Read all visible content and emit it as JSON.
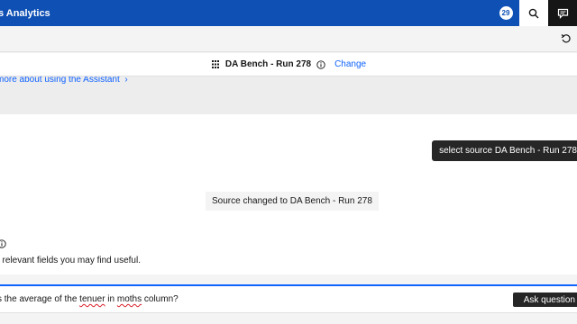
{
  "header": {
    "app_title": "s Analytics",
    "notification_count": "29"
  },
  "source_bar": {
    "source_name": "DA Bench - Run 278",
    "change_label": "Change"
  },
  "assistant": {
    "learn_more_text": "more about using the Assistant"
  },
  "chat": {
    "user_message": "select source DA Bench - Run 278",
    "system_message": "Source changed to DA Bench - Run 278",
    "fields_text": "f relevant fields you may find useful."
  },
  "input": {
    "text_before": "s the average of the ",
    "word_1": "tenuer",
    "text_middle": " in ",
    "word_2": "moths",
    "text_after": " column?",
    "ask_label": "Ask question"
  }
}
